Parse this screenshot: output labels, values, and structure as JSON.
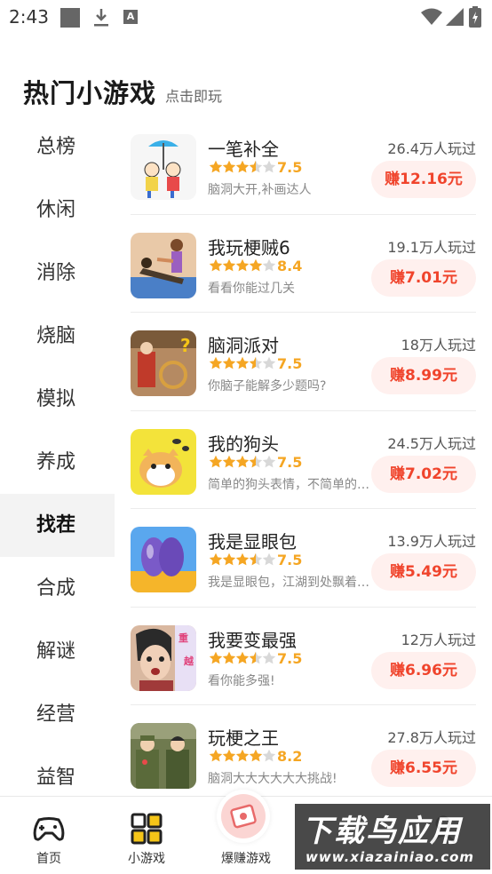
{
  "status_bar": {
    "time": "2:43",
    "icons": [
      "square-icon",
      "download-icon",
      "a-icon",
      "wifi-icon",
      "signal-icon",
      "battery-icon"
    ]
  },
  "header": {
    "title": "热门小游戏",
    "subtitle": "点击即玩"
  },
  "sidebar": {
    "active_index": 6,
    "items": [
      {
        "label": "总榜"
      },
      {
        "label": "休闲"
      },
      {
        "label": "消除"
      },
      {
        "label": "烧脑"
      },
      {
        "label": "模拟"
      },
      {
        "label": "养成"
      },
      {
        "label": "找茬"
      },
      {
        "label": "合成"
      },
      {
        "label": "解谜"
      },
      {
        "label": "经营"
      },
      {
        "label": "益智"
      }
    ]
  },
  "games": [
    {
      "name": "一笔补全",
      "rating": "7.5",
      "stars": 3.5,
      "desc": "脑洞大开,补画达人",
      "plays": "26.4万人玩过",
      "earn": "赚12.16元",
      "thumb_color": "#f6f6f6"
    },
    {
      "name": "我玩梗贼6",
      "rating": "8.4",
      "stars": 4,
      "desc": "看看你能过几关",
      "plays": "19.1万人玩过",
      "earn": "赚7.01元",
      "thumb_color": "#e9c9a8"
    },
    {
      "name": "脑洞派对",
      "rating": "7.5",
      "stars": 3.5,
      "desc": "你脑子能解多少题吗?",
      "plays": "18万人玩过",
      "earn": "赚8.99元",
      "thumb_color": "#b58a62"
    },
    {
      "name": "我的狗头",
      "rating": "7.5",
      "stars": 3.5,
      "desc": "简单的狗头表情，不简单的游戏",
      "plays": "24.5万人玩过",
      "earn": "赚7.02元",
      "thumb_color": "#f3e33a"
    },
    {
      "name": "我是显眼包",
      "rating": "7.5",
      "stars": 3.5,
      "desc": "我是显眼包，江湖到处飘着我的传说",
      "plays": "13.9万人玩过",
      "earn": "赚5.49元",
      "thumb_color": "#5aa7ee"
    },
    {
      "name": "我要变最强",
      "rating": "7.5",
      "stars": 3.5,
      "desc": "看你能多强!",
      "plays": "12万人玩过",
      "earn": "赚6.96元",
      "thumb_color": "#d9b8a0"
    },
    {
      "name": "玩梗之王",
      "rating": "8.2",
      "stars": 4,
      "desc": "脑洞大大大大大大挑战!",
      "plays": "27.8万人玩过",
      "earn": "赚6.55元",
      "thumb_color": "#6f7a4f"
    }
  ],
  "bottom_nav": {
    "items": [
      {
        "label": "首页",
        "icon": "gamepad-icon"
      },
      {
        "label": "小游戏",
        "icon": "grid-icon"
      },
      {
        "label": "爆赚游戏",
        "icon": "money-envelope-icon"
      },
      {
        "label": "",
        "icon": "profile-icon"
      }
    ]
  },
  "watermark": {
    "big": "下载鸟应用",
    "small": "www.xiazainiao.com"
  },
  "colors": {
    "accent_red": "#f0442c",
    "earn_bg": "#fff0ee",
    "star_gold": "#f5a623",
    "star_empty": "#d8d8d8",
    "sidebar_active_bg": "#f3f3f3"
  }
}
